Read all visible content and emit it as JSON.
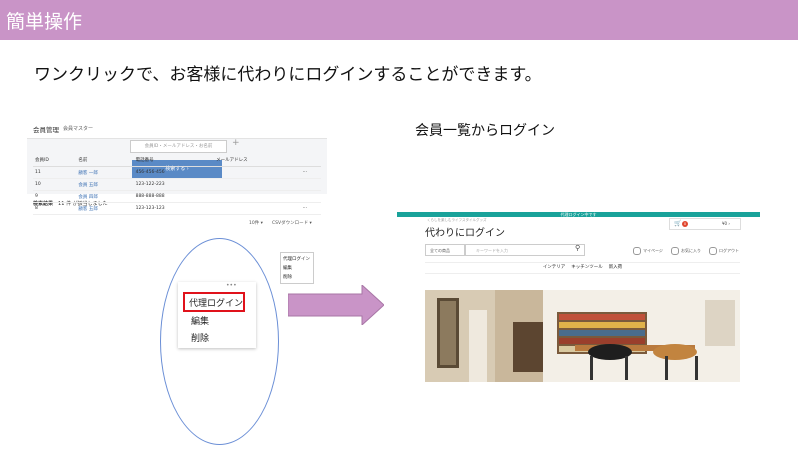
{
  "slide": {
    "title": "簡単操作",
    "subtitle": "ワンクリックで、お客様に代わりにログインすることができます。",
    "caption": "会員一覧からログイン",
    "colors": {
      "header": "#c994c7",
      "arrow": "#c994c7",
      "highlight": "#e0121b",
      "ellipse": "#6b8fd6"
    }
  },
  "admin": {
    "title": "会員管理",
    "breadcrumb": "会員マスター",
    "search_placeholder": "会員ID・メールアドレス・お名前",
    "search_button": "検索する ›",
    "result_label": "検索結果",
    "result_count": "11 件 が該当しました",
    "per_page": "10件 ▾",
    "csv_label": "CSVダウンロード ▾",
    "columns": [
      "会員ID",
      "名前",
      "電話番号",
      "メールアドレス"
    ],
    "rows": [
      {
        "id": "11",
        "name": "顧客 一郎",
        "phone": "456-456-456"
      },
      {
        "id": "10",
        "name": "会員 五郎",
        "phone": "123-122-223"
      },
      {
        "id": "9",
        "name": "会員 四郎",
        "phone": "888-888-888"
      },
      {
        "id": "8",
        "name": "顧客 五郎",
        "phone": "123-123-123"
      }
    ],
    "dropdown": [
      "代理ログイン",
      "編集",
      "削除"
    ]
  },
  "zoom": {
    "dots": "•••",
    "items": [
      "代理ログイン",
      "編集",
      "削除"
    ]
  },
  "store": {
    "banner": "代理ログイン中です",
    "tagline": "くらしを楽しむライフスタイルグッズ",
    "logo": "代わりにログイン",
    "cart_badge": "0",
    "cart_amount": "¥0 ›",
    "category": "全ての商品",
    "keyword_placeholder": "キーワードを入力",
    "links": [
      "マイページ",
      "お気に入り",
      "ログアウト"
    ],
    "nav": [
      "インテリア",
      "キッチンツール",
      "新入荷"
    ]
  }
}
